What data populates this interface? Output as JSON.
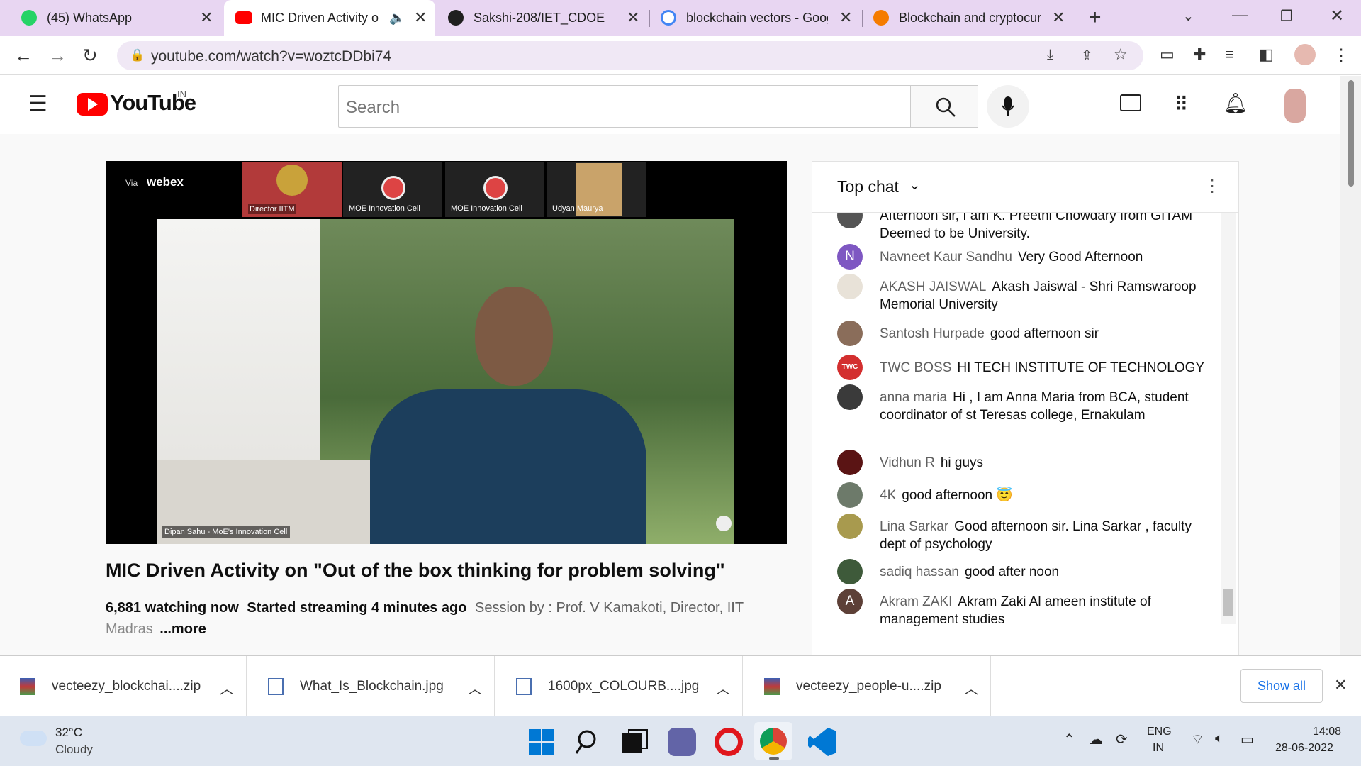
{
  "browser": {
    "tabs": [
      {
        "title": "(45) WhatsApp",
        "badge": "45"
      },
      {
        "title": "MIC Driven Activity o"
      },
      {
        "title": "Sakshi-208/IET_CDOE"
      },
      {
        "title": "blockchain vectors - Goog"
      },
      {
        "title": "Blockchain and cryptocurr"
      }
    ],
    "new_tab": "+",
    "url": "youtube.com/watch?v=woztcDDbi74"
  },
  "youtube": {
    "logo_text": "YouTube",
    "region": "IN",
    "search_placeholder": "Search"
  },
  "video": {
    "overlay_via": "Via",
    "overlay_brand": "webex",
    "participants": [
      "Director IITM",
      "MOE Innovation Cell",
      "MOE Innovation Cell",
      "Udyan Maurya"
    ],
    "speaker_label": "Dipan Sahu - MoE's Innovation Cell",
    "title": "MIC Driven Activity on \"Out of the box thinking for problem solving\"",
    "watching": "6,881 watching now",
    "started": "Started streaming 4 minutes ago",
    "description": "Session by : Prof. V Kamakoti, Director, IIT",
    "description_line2": "Madras",
    "more": "...more"
  },
  "chat": {
    "header": "Top chat",
    "messages": [
      {
        "author": "",
        "text": "Afternoon sir, I am K. Preethi Chowdary from GITAM Deemed to be University.",
        "avatar_color": "#555555",
        "initial": ""
      },
      {
        "author": "Navneet Kaur Sandhu",
        "text": "Very Good Afternoon",
        "avatar_color": "#7e57c2",
        "initial": "N"
      },
      {
        "author": "AKASH JAISWAL",
        "text": "Akash Jaiswal - Shri Ramswaroop Memorial University",
        "avatar_color": "#c8b49a",
        "initial": ""
      },
      {
        "author": "Santosh Hurpade",
        "text": "good afternoon sir",
        "avatar_color": "#8a6d5a",
        "initial": ""
      },
      {
        "author": "TWC BOSS",
        "text": "HI TECH INSTITUTE OF TECHNOLOGY",
        "avatar_color": "#d32f2f",
        "initial": "TWC"
      },
      {
        "author": "anna maria",
        "text": "Hi , I am Anna Maria from BCA, student coordinator of st Teresas college, Ernakulam",
        "avatar_color": "#3a3a3a",
        "initial": ""
      },
      {
        "author": "Vidhun R",
        "text": "hi guys",
        "avatar_color": "#5a1414",
        "initial": ""
      },
      {
        "author": "4K",
        "text": "good afternoon 😇",
        "avatar_color": "#6d7a6a",
        "initial": ""
      },
      {
        "author": "Lina Sarkar",
        "text": "Good afternoon sir. Lina Sarkar , faculty dept of psychology",
        "avatar_color": "#a89a4e",
        "initial": ""
      },
      {
        "author": "sadiq hassan",
        "text": "good after noon",
        "avatar_color": "#3e5a3a",
        "initial": ""
      },
      {
        "author": "Akram ZAKI",
        "text": "Akram Zaki Al ameen institute of management studies",
        "avatar_color": "#5d4037",
        "initial": "A"
      }
    ]
  },
  "downloads": {
    "items": [
      "vecteezy_blockchai....zip",
      "What_Is_Blockchain.jpg",
      "1600px_COLOURB....jpg",
      "vecteezy_people-u....zip"
    ],
    "show_all": "Show all"
  },
  "taskbar": {
    "weather_temp": "32°C",
    "weather_desc": "Cloudy",
    "lang1": "ENG",
    "lang2": "IN",
    "time": "14:08",
    "date": "28-06-2022"
  }
}
